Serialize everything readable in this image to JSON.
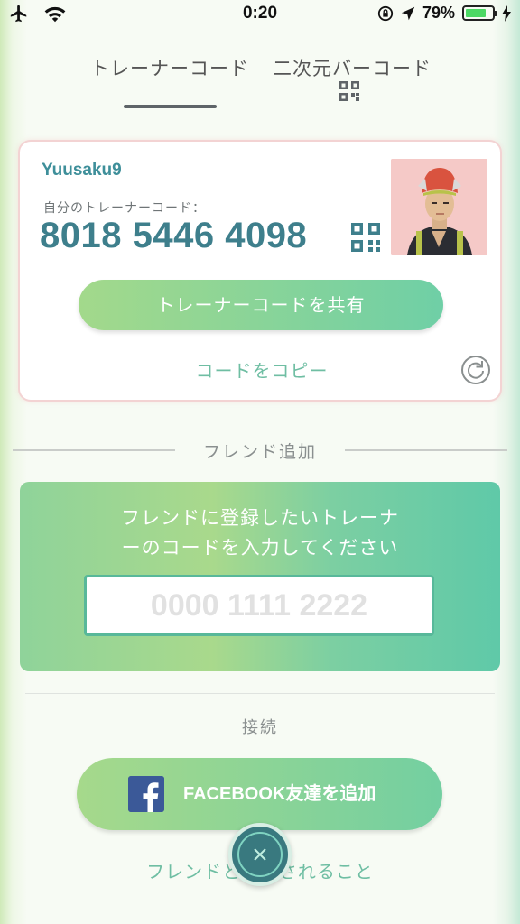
{
  "status_bar": {
    "time": "0:20",
    "battery_percent": "79%",
    "battery_level": 0.79,
    "icons": [
      "airplane-icon",
      "wifi-icon",
      "orientation-lock-icon",
      "location-arrow-icon",
      "battery-icon",
      "charging-bolt-icon"
    ]
  },
  "tabs": [
    {
      "label": "トレーナーコード",
      "active": true
    },
    {
      "label": "二次元バーコード",
      "active": false,
      "icon": "qr-code-icon"
    }
  ],
  "trainer_card": {
    "name": "Yuusaku9",
    "code_label": "自分のトレーナーコード：",
    "code": "8018 5446 4098",
    "share_button": "トレーナーコードを共有",
    "copy_link": "コードをコピー"
  },
  "add_friend": {
    "section_title": "フレンド追加",
    "instruction_line1": "フレンドに登録したいトレーナ",
    "instruction_line2": "ーのコードを入力してください",
    "input_placeholder": "0000 1111 2222",
    "input_value": ""
  },
  "connect": {
    "section_title": "接続",
    "facebook_button": "FACEBOOK友達を追加",
    "footer_link": "フレンドとの　されること"
  },
  "colors": {
    "accent_teal": "#3e7f8c",
    "button_green_start": "#a3d98b",
    "button_green_end": "#6fcfa6",
    "facebook_blue": "#3b5998",
    "close_button": "#39797f"
  }
}
